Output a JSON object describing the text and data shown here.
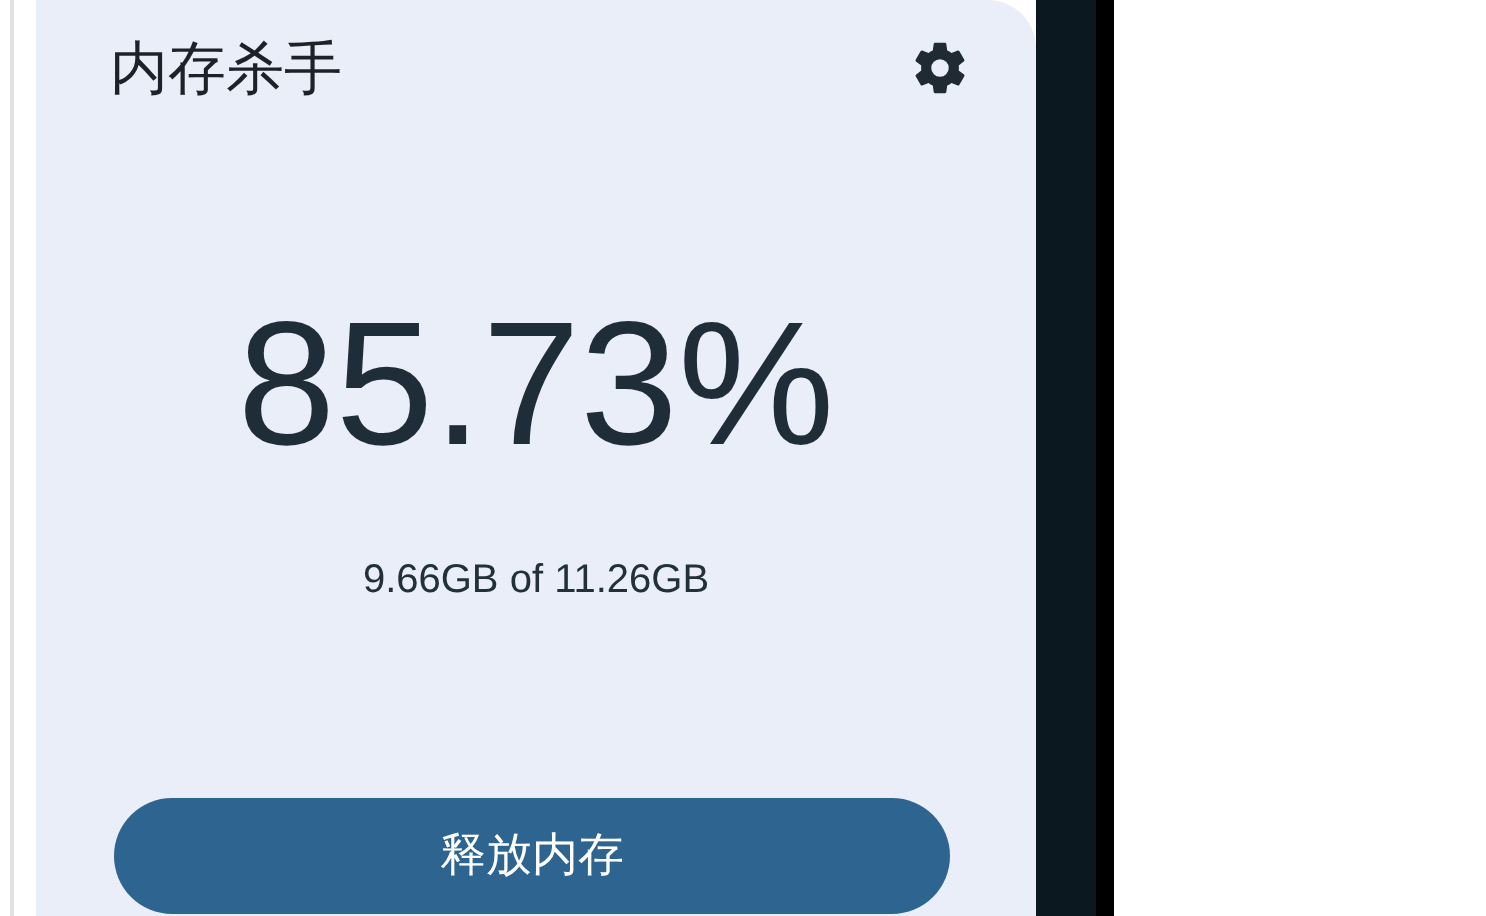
{
  "app": {
    "title": "内存杀手"
  },
  "memory": {
    "percent": "85.73%",
    "detail": "9.66GB of 11.26GB"
  },
  "button": {
    "label": "释放内存"
  }
}
